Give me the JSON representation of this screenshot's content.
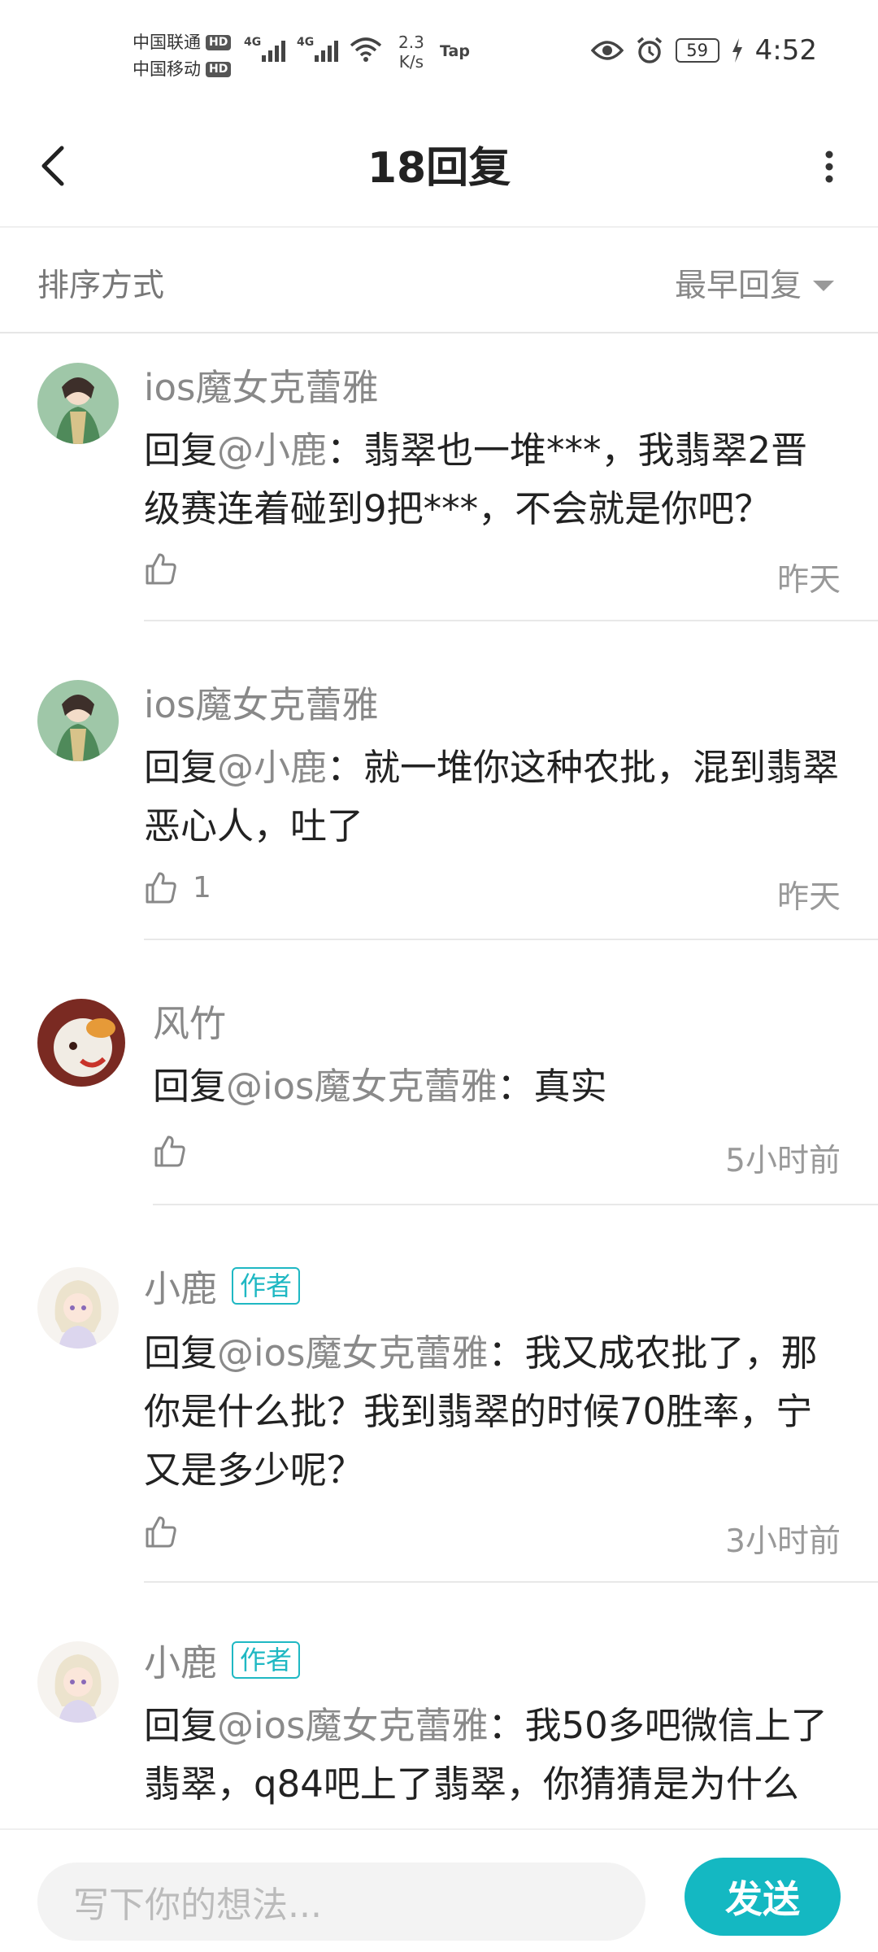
{
  "status_bar": {
    "carrier1": "中国联通",
    "carrier2": "中国移动",
    "hd": "HD",
    "net1": "4G",
    "net2": "4G",
    "speed_value": "2.3",
    "speed_unit": "K/s",
    "tap": "Tap",
    "battery": "59",
    "time": "4:52"
  },
  "header": {
    "title": "18回复"
  },
  "sort": {
    "label": "排序方式",
    "value": "最早回复"
  },
  "comments": [
    {
      "name": "ios魔女克蕾雅",
      "reply_prefix": "回复",
      "mention": "@小鹿",
      "text": "：翡翠也一堆***，我翡翠2晋级赛连着碰到9把***，不会就是你吧？",
      "likes": "",
      "time": "昨天"
    },
    {
      "name": "ios魔女克蕾雅",
      "reply_prefix": "回复",
      "mention": "@小鹿",
      "text": "：就一堆你这种农批，混到翡翠恶心人，吐了",
      "likes": "1",
      "time": "昨天"
    },
    {
      "name": "风竹",
      "reply_prefix": "回复",
      "mention": "@ios魔女克蕾雅",
      "text": "：真实",
      "likes": "",
      "time": "5小时前"
    },
    {
      "name": "小鹿",
      "author_tag": "作者",
      "reply_prefix": "回复",
      "mention": "@ios魔女克蕾雅",
      "text": "：我又成农批了，那你是什么批？我到翡翠的时候70胜率，宁又是多少呢？",
      "likes": "",
      "time": "3小时前"
    },
    {
      "name": "小鹿",
      "author_tag": "作者",
      "reply_prefix": "回复",
      "mention": "@ios魔女克蕾雅",
      "text": "：我50多吧微信上了翡翠，q84吧上了翡翠，你猜猜是为什么",
      "likes": "",
      "time": ""
    }
  ],
  "input": {
    "placeholder": "写下你的想法...",
    "send_label": "发送"
  },
  "colors": {
    "accent": "#14b8c2",
    "author_tag": "#1fb8c3"
  }
}
